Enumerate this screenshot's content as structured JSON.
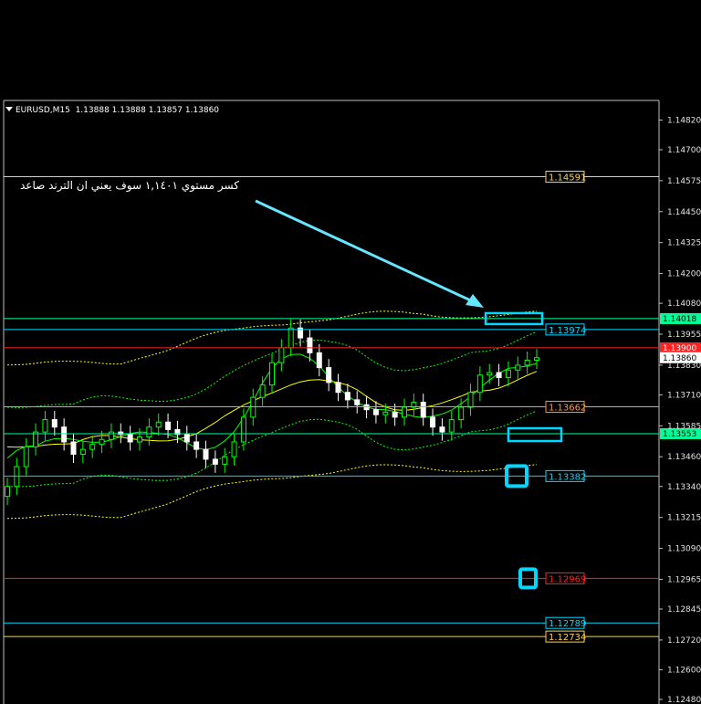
{
  "header": {
    "symbol": "EURUSD,M15",
    "ohlc": "1.13888 1.13888 1.13857 1.13860"
  },
  "annotation": {
    "text": "كسر مستوي ١,١٤٠١ سوف يعني ان الترند صاعد"
  },
  "colors": {
    "background": "#000000",
    "bull_candle": "#00ff00",
    "bear_candle": "#ffffff",
    "envelope": "#ffff00",
    "envelope_inner": "#00ff00",
    "cyan": "#00d8ff",
    "green_line": "#00ff99",
    "orange": "#ff9933",
    "red": "#ff2222",
    "yellow": "#ffff00"
  },
  "chart_data": {
    "type": "candlestick",
    "ylim": [
      1.1248,
      1.1484
    ],
    "y_ticks": [
      "1.14820",
      "1.14700",
      "1.14575",
      "1.14450",
      "1.14325",
      "1.14200",
      "1.14080",
      "1.13955",
      "1.13830",
      "1.13710",
      "1.13585",
      "1.13460",
      "1.13340",
      "1.13215",
      "1.13090",
      "1.12965",
      "1.12845",
      "1.12720",
      "1.12600",
      "1.12480"
    ],
    "current_price": "1.13860",
    "horizontal_levels": [
      {
        "label": "1.14591",
        "value": 1.14591,
        "color": "#ffd24d"
      },
      {
        "label": "1.14018",
        "value": 1.14018,
        "color": "#00ff99"
      },
      {
        "label": "1.13974",
        "value": 1.13974,
        "color": "#00d8ff"
      },
      {
        "label": "1.13900",
        "value": 1.139,
        "color": "#ff2222"
      },
      {
        "label": "1.13662",
        "value": 1.13662,
        "color": "#ff9933"
      },
      {
        "label": "1.13553",
        "value": 1.13553,
        "color": "#00ff99"
      },
      {
        "label": "1.13382",
        "value": 1.13382,
        "color": "#00d8ff"
      },
      {
        "label": "1.12969",
        "value": 1.12969,
        "color": "#ff2222"
      },
      {
        "label": "1.12789",
        "value": 1.12789,
        "color": "#00d8ff"
      },
      {
        "label": "1.12734",
        "value": 1.12734,
        "color": "#ffd24d"
      }
    ],
    "close_series": [
      1.1334,
      1.1342,
      1.135,
      1.1356,
      1.1361,
      1.1358,
      1.1352,
      1.1347,
      1.1349,
      1.1351,
      1.1353,
      1.1356,
      1.1355,
      1.1352,
      1.1354,
      1.1358,
      1.136,
      1.1357,
      1.1355,
      1.1352,
      1.1349,
      1.1345,
      1.1343,
      1.1346,
      1.1352,
      1.1362,
      1.137,
      1.1375,
      1.1384,
      1.139,
      1.1398,
      1.1394,
      1.1388,
      1.1382,
      1.1376,
      1.1372,
      1.1369,
      1.1367,
      1.1365,
      1.1363,
      1.1364,
      1.1362,
      1.1366,
      1.1368,
      1.1362,
      1.1358,
      1.1356,
      1.1361,
      1.1366,
      1.1372,
      1.1379,
      1.138,
      1.1378,
      1.1381,
      1.1383,
      1.1385,
      1.1386
    ]
  }
}
